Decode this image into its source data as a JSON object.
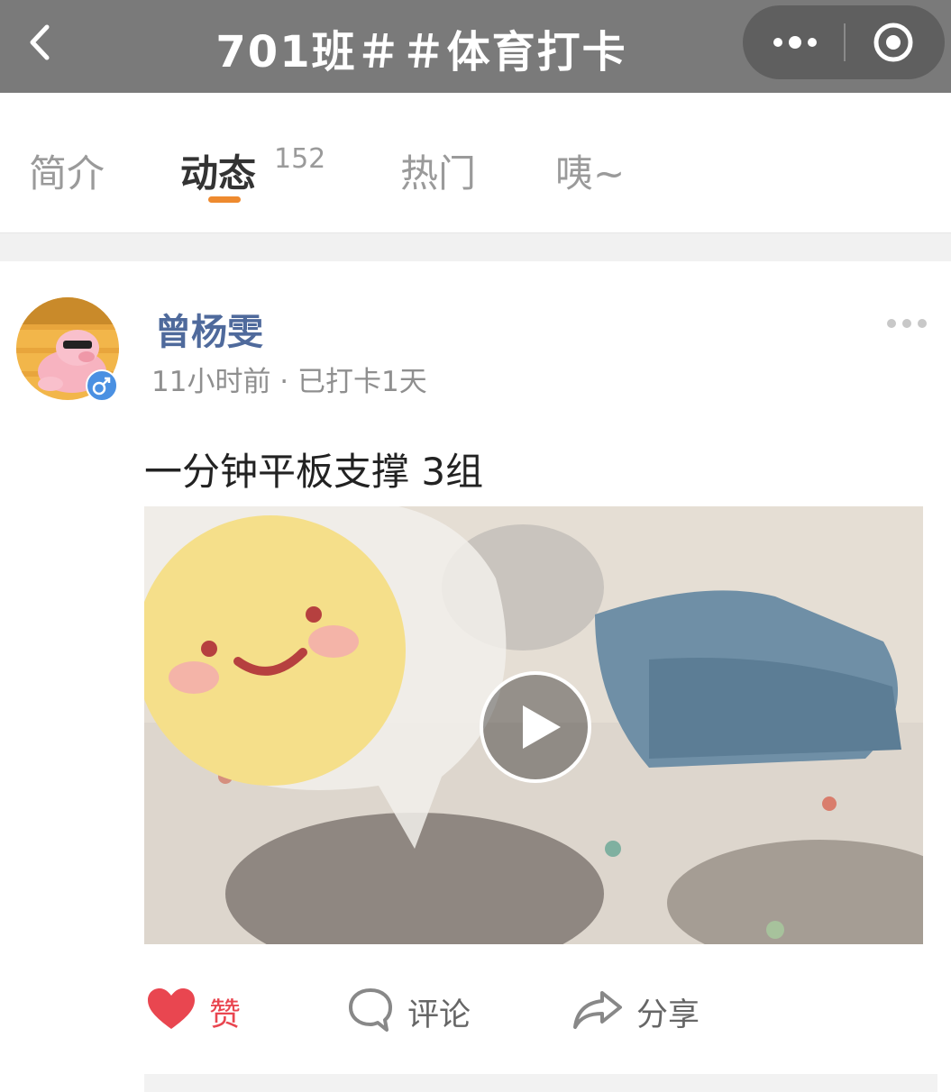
{
  "navbar": {
    "title": "701班＃＃体育打卡",
    "back_icon": "chevron-left-icon",
    "more_icon": "more-dots-icon",
    "close_icon": "target-circle-icon"
  },
  "tabs": [
    {
      "label": "简介"
    },
    {
      "label": "动态",
      "count": "152"
    },
    {
      "label": "热门"
    },
    {
      "label": "咦~"
    }
  ],
  "post": {
    "username": "曾杨雯",
    "meta": "11小时前 · 已打卡1天",
    "text": "一分钟平板支撑 3组",
    "video_play_icon": "play-icon"
  },
  "actions": {
    "like_label": "赞",
    "comment_label": "评论",
    "share_label": "分享"
  },
  "colors": {
    "accent": "#ee8a2f",
    "like": "#e94650",
    "username": "#4f6a9c",
    "navbar": "#7a7a7a"
  }
}
